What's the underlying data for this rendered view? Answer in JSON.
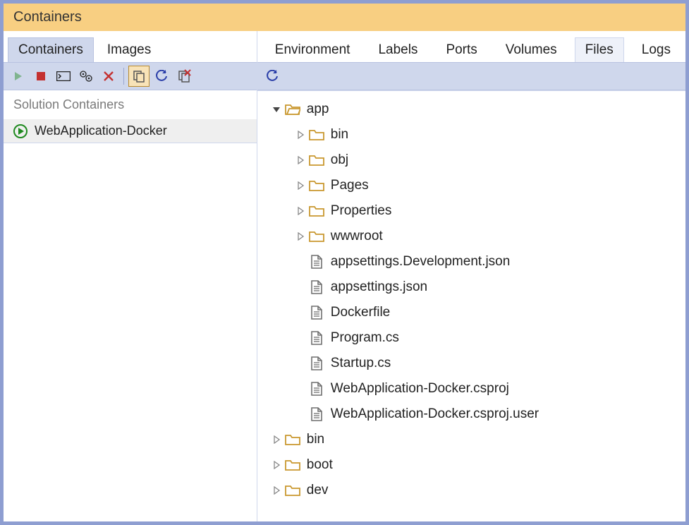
{
  "title": "Containers",
  "leftTabs": [
    {
      "label": "Containers",
      "active": true
    },
    {
      "label": "Images",
      "active": false
    }
  ],
  "rightTabs": [
    {
      "label": "Environment",
      "active": false
    },
    {
      "label": "Labels",
      "active": false
    },
    {
      "label": "Ports",
      "active": false
    },
    {
      "label": "Volumes",
      "active": false
    },
    {
      "label": "Files",
      "active": true
    },
    {
      "label": "Logs",
      "active": false
    }
  ],
  "sectionHeader": "Solution Containers",
  "containers": [
    {
      "name": "WebApplication-Docker",
      "running": true
    }
  ],
  "tree": [
    {
      "depth": 0,
      "kind": "folder-open",
      "label": "app",
      "expander": "down"
    },
    {
      "depth": 1,
      "kind": "folder",
      "label": "bin",
      "expander": "right"
    },
    {
      "depth": 1,
      "kind": "folder",
      "label": "obj",
      "expander": "right"
    },
    {
      "depth": 1,
      "kind": "folder",
      "label": "Pages",
      "expander": "right"
    },
    {
      "depth": 1,
      "kind": "folder",
      "label": "Properties",
      "expander": "right"
    },
    {
      "depth": 1,
      "kind": "folder",
      "label": "wwwroot",
      "expander": "right"
    },
    {
      "depth": 1,
      "kind": "file",
      "label": "appsettings.Development.json",
      "expander": "none"
    },
    {
      "depth": 1,
      "kind": "file",
      "label": "appsettings.json",
      "expander": "none"
    },
    {
      "depth": 1,
      "kind": "file",
      "label": "Dockerfile",
      "expander": "none"
    },
    {
      "depth": 1,
      "kind": "file",
      "label": "Program.cs",
      "expander": "none"
    },
    {
      "depth": 1,
      "kind": "file",
      "label": "Startup.cs",
      "expander": "none"
    },
    {
      "depth": 1,
      "kind": "file",
      "label": "WebApplication-Docker.csproj",
      "expander": "none"
    },
    {
      "depth": 1,
      "kind": "file",
      "label": "WebApplication-Docker.csproj.user",
      "expander": "none"
    },
    {
      "depth": 0,
      "kind": "folder",
      "label": "bin",
      "expander": "right"
    },
    {
      "depth": 0,
      "kind": "folder",
      "label": "boot",
      "expander": "right"
    },
    {
      "depth": 0,
      "kind": "folder",
      "label": "dev",
      "expander": "right"
    }
  ],
  "colors": {
    "folder": "#c9982f",
    "file": "#6f6f6f",
    "run": "#1f8a1f"
  }
}
